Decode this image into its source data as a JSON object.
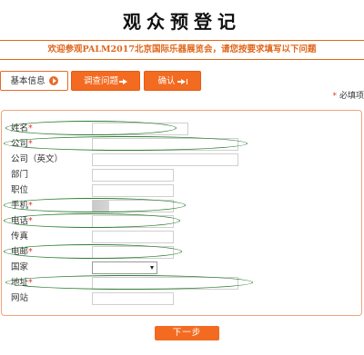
{
  "page_title": "观众预登记",
  "banner": "欢迎参观PALM2017北京国际乐器展览会，请您按要求填写以下问题",
  "tabs": [
    {
      "label": "基本信息",
      "state": "active"
    },
    {
      "label": "调查问题",
      "state": "inactive"
    },
    {
      "label": "确认",
      "state": "inactive"
    }
  ],
  "required_note": {
    "star": "*",
    "text": "必填项"
  },
  "fields": [
    {
      "label": "姓名",
      "required": true,
      "value": "",
      "type": "text"
    },
    {
      "label": "公司",
      "required": true,
      "value": "",
      "type": "text"
    },
    {
      "label": "公司（英文）",
      "required": false,
      "value": "",
      "type": "text"
    },
    {
      "label": "部门",
      "required": false,
      "value": "",
      "type": "text"
    },
    {
      "label": "职位",
      "required": false,
      "value": "",
      "type": "text"
    },
    {
      "label": "手机",
      "required": true,
      "value": "",
      "type": "text"
    },
    {
      "label": "电话",
      "required": true,
      "value": "",
      "type": "text"
    },
    {
      "label": "传真",
      "required": false,
      "value": "",
      "type": "text"
    },
    {
      "label": "电邮",
      "required": true,
      "value": "",
      "type": "text"
    },
    {
      "label": "国家",
      "required": false,
      "value": "",
      "type": "select"
    },
    {
      "label": "地址",
      "required": true,
      "value": "",
      "type": "text"
    },
    {
      "label": "网站",
      "required": false,
      "value": "",
      "type": "text"
    }
  ],
  "next_button": "下一步",
  "colors": {
    "accent": "#f36b21",
    "banner_text": "#e0661b",
    "required": "#d63a2a",
    "annotation": "#2e7d32"
  }
}
